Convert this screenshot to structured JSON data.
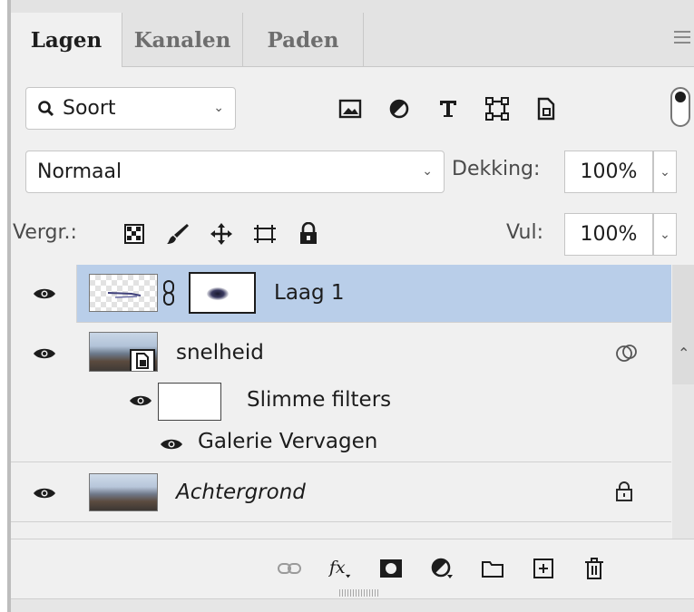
{
  "tabs": [
    {
      "label": "Lagen",
      "active": true
    },
    {
      "label": "Kanalen",
      "active": false
    },
    {
      "label": "Paden",
      "active": false
    }
  ],
  "filter": {
    "kind_label": "Soort",
    "icons": [
      "image-filter-icon",
      "adjustment-filter-icon",
      "type-filter-icon",
      "shape-filter-icon",
      "smart-object-filter-icon"
    ]
  },
  "blend": {
    "mode": "Normaal",
    "opacity_label": "Dekking:",
    "opacity_value": "100%"
  },
  "lock": {
    "label": "Vergr.:",
    "fill_label": "Vul:",
    "fill_value": "100%"
  },
  "layers": [
    {
      "name": "Laag 1",
      "selected": true
    },
    {
      "name": "snelheid",
      "selected": false
    },
    {
      "name": "Slimme filters",
      "selected": false
    },
    {
      "name": "Galerie Vervagen",
      "selected": false
    },
    {
      "name": "Achtergrond",
      "selected": false
    }
  ],
  "colors": {
    "selected_row": "#b9cee9",
    "panel_bg": "#f0f0f0",
    "tab_bar": "#e3e3e3"
  }
}
